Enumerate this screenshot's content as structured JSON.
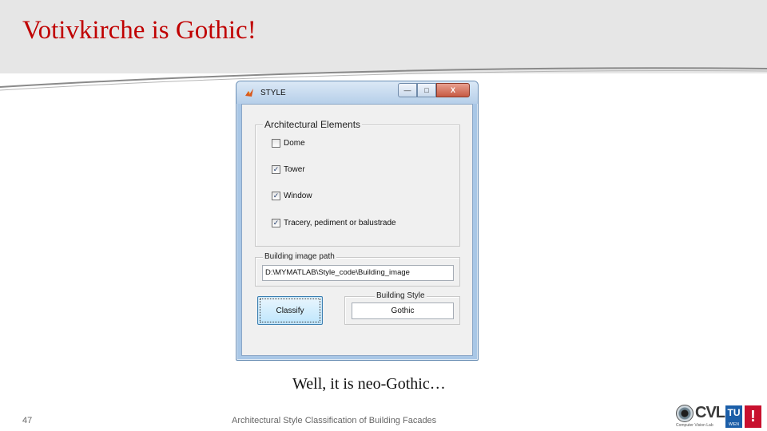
{
  "slide": {
    "title": "Votivkirche is Gothic!",
    "caption": "Well, it is neo-Gothic…",
    "page_number": "47",
    "footer": "Architectural Style Classification of Building Facades"
  },
  "window": {
    "title": "STYLE",
    "controls": {
      "minimize": "—",
      "maximize": "□",
      "close": "X"
    }
  },
  "architectural_elements": {
    "label": "Architectural Elements",
    "items": [
      {
        "label": "Dome",
        "checked": false,
        "mark": ""
      },
      {
        "label": "Tower",
        "checked": true,
        "mark": "✓"
      },
      {
        "label": "Window",
        "checked": true,
        "mark": "✓"
      },
      {
        "label": "Tracery, pediment or balustrade",
        "checked": true,
        "mark": "✓"
      }
    ]
  },
  "image_path": {
    "label": "Building image path",
    "value": "D:\\MYMATLAB\\Style_code\\Building_image"
  },
  "classify_button": {
    "label": "Classify"
  },
  "building_style": {
    "label": "Building Style",
    "value": "Gothic"
  },
  "logo": {
    "cvl": "CVL",
    "subtitle": "Computer Vision Lab",
    "tu": "TU",
    "tu_sub": "WIEN",
    "mark": "!"
  },
  "colors": {
    "title": "#c00000",
    "header_bg": "#e6e6e6",
    "window_frame": "#a9c7e6",
    "tu_blue": "#1b5ea8",
    "tu_red": "#c8102e"
  }
}
